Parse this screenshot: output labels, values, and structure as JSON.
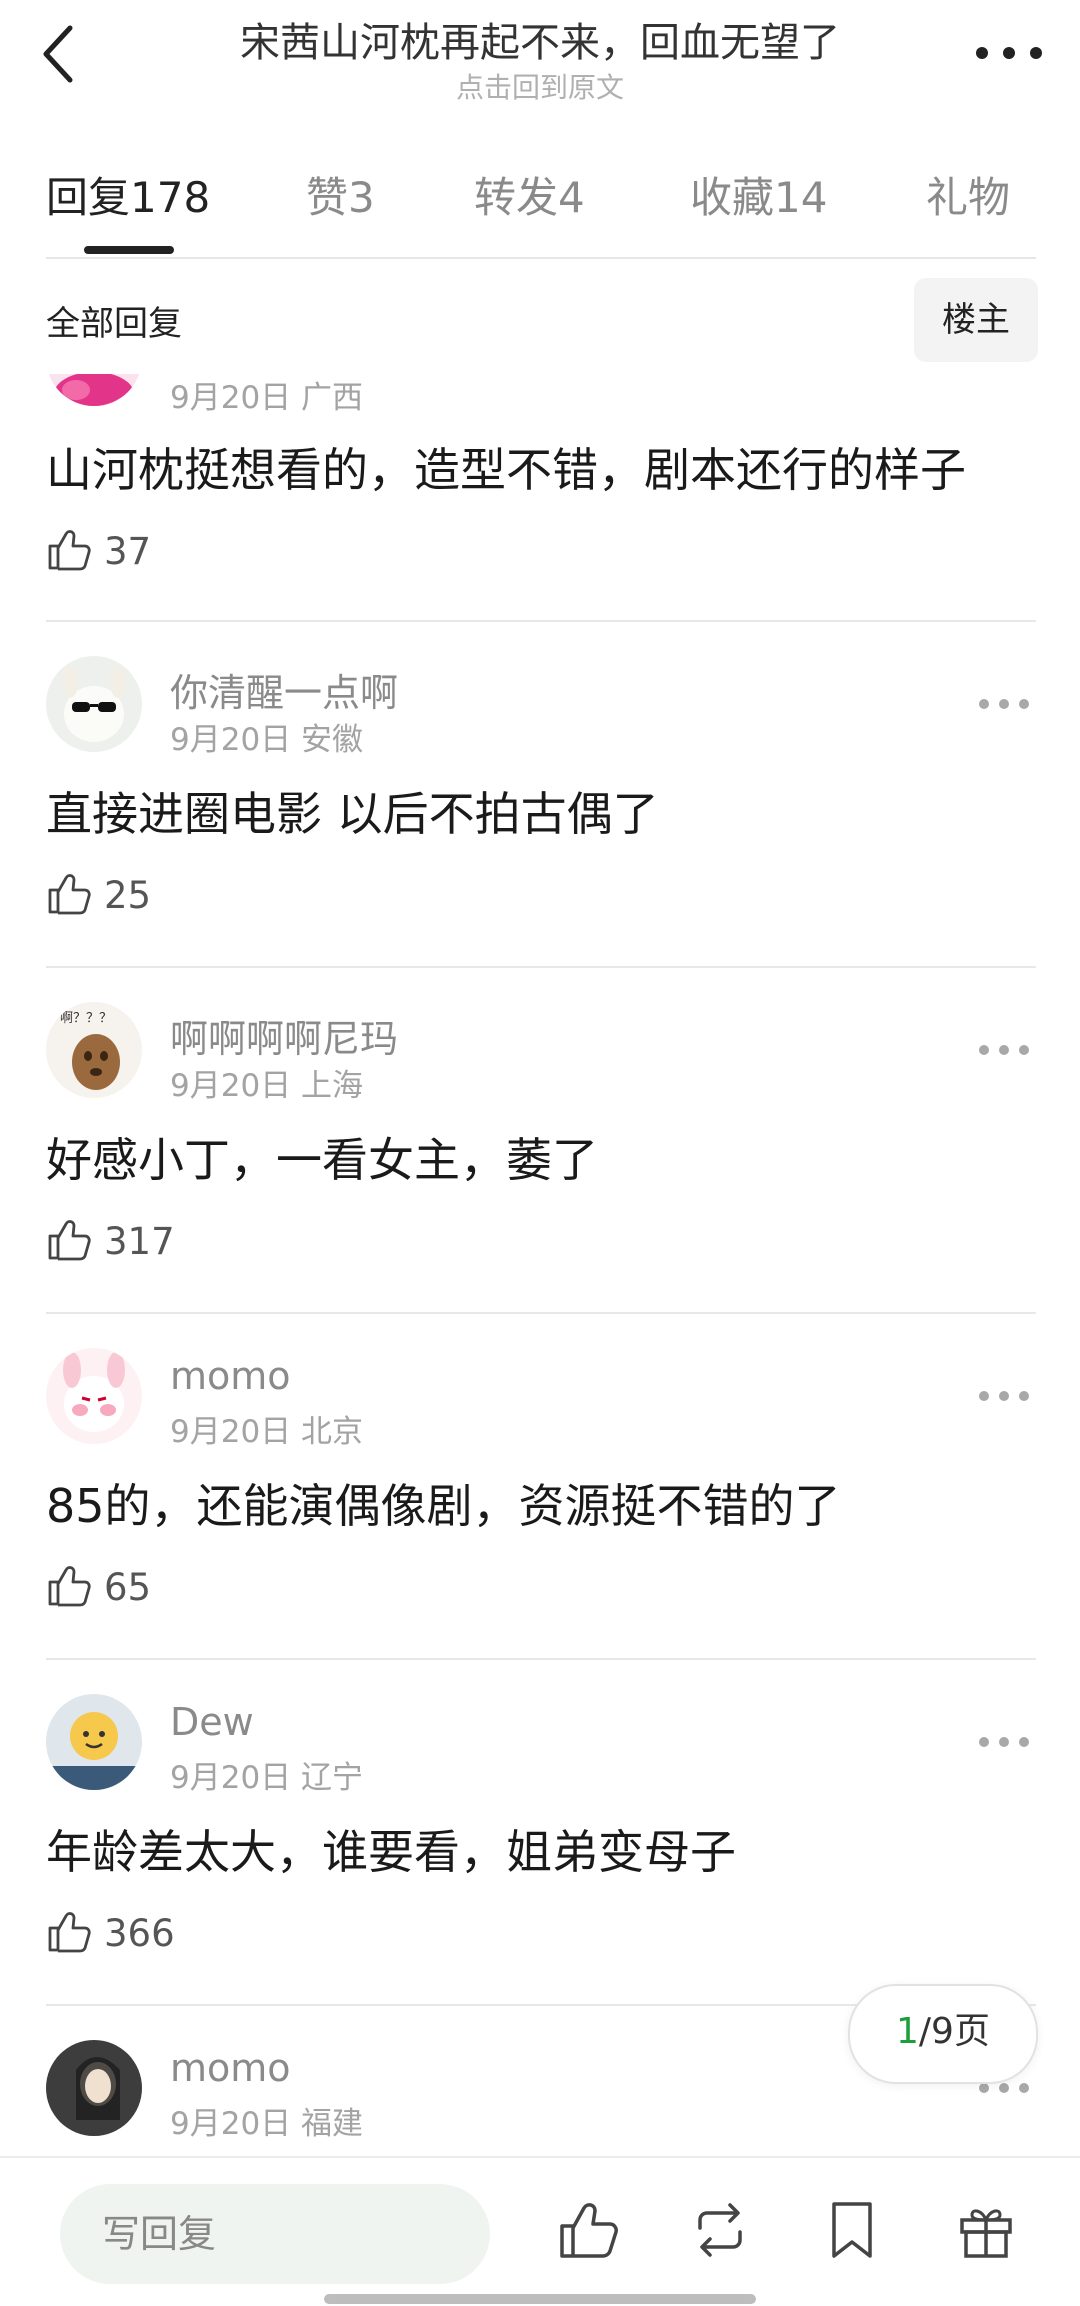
{
  "header": {
    "title": "宋茜山河枕再起不来，回血无望了",
    "subtitle": "点击回到原文"
  },
  "tabs": [
    {
      "label": "回复",
      "count": "178"
    },
    {
      "label": "赞",
      "count": "3"
    },
    {
      "label": "转发",
      "count": "4"
    },
    {
      "label": "收藏",
      "count": "14"
    },
    {
      "label": "礼物",
      "count": ""
    }
  ],
  "filter": {
    "label": "全部回复",
    "owner_button": "楼主"
  },
  "comments": [
    {
      "name": "",
      "meta": "9月20日 广西",
      "text": "山河枕挺想看的，造型不错，剧本还行的样子",
      "likes": "37"
    },
    {
      "name": "你清醒一点啊",
      "meta": "9月20日 安徽",
      "text": "直接进圈电影 以后不拍古偶了",
      "likes": "25"
    },
    {
      "name": "啊啊啊啊尼玛",
      "meta": "9月20日 上海",
      "text": "好感小丁，一看女主，萎了",
      "likes": "317"
    },
    {
      "name": "momo",
      "meta": "9月20日 北京",
      "text": "85的，还能演偶像剧，资源挺不错的了",
      "likes": "65"
    },
    {
      "name": "Dew",
      "meta": "9月20日 辽宁",
      "text": "年龄差太大，谁要看，姐弟变母子",
      "likes": "366"
    },
    {
      "name": "momo",
      "meta": "9月20日 福建",
      "text": "",
      "likes": ""
    }
  ],
  "avatar_texts": {
    "comment3": "啊？？？"
  },
  "pagination": {
    "current": "1",
    "total_text": "/9页"
  },
  "bottom": {
    "reply_placeholder": "写回复"
  },
  "colors": {
    "accent_green": "#1a9f3a",
    "muted_text": "#8a8a8a"
  }
}
